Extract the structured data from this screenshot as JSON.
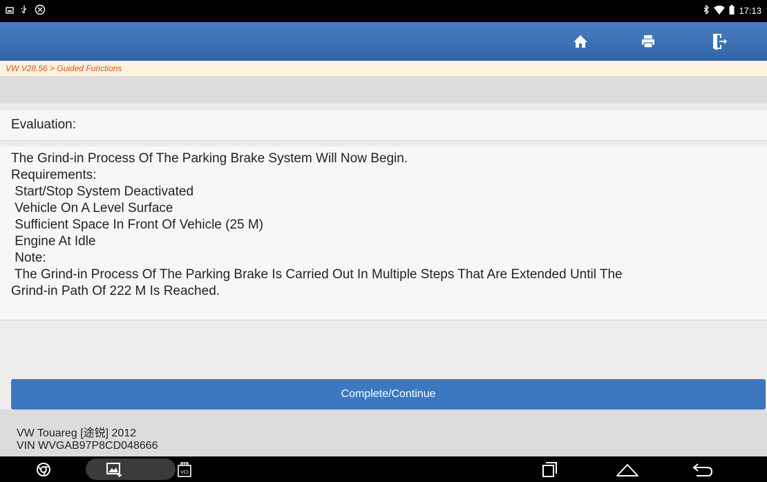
{
  "status_bar": {
    "time": "17:13",
    "left_icons": [
      "image-icon",
      "usb-icon",
      "nfc-icon"
    ],
    "right_icons": [
      "bluetooth-icon",
      "wifi-icon",
      "battery-icon"
    ]
  },
  "toolbar": {
    "buttons": [
      "home-icon",
      "print-icon",
      "exit-icon"
    ]
  },
  "breadcrumb": "VW V28.56 > Guided Functions",
  "evaluation_label": "Evaluation:",
  "content": {
    "lines": [
      "The Grind-in Process Of The Parking Brake System Will Now Begin.",
      "Requirements:",
      " Start/Stop System Deactivated",
      " Vehicle On A Level Surface",
      " Sufficient Space In Front Of Vehicle (25 M)",
      " Engine At Idle",
      " Note:",
      " The Grind-in Process Of The Parking Brake Is Carried Out In Multiple Steps That Are Extended Until The",
      "Grind-in Path Of 222 M Is Reached."
    ]
  },
  "continue_label": "Complete/Continue",
  "vehicle": {
    "model": "VW Touareg [途锐] 2012",
    "vin": "VIN WVGAB97P8CD048666"
  },
  "nav_bar": {
    "items": [
      "chrome-icon",
      "gallery-icon",
      "vci-icon",
      "recents-icon",
      "home-nav-icon",
      "back-icon"
    ],
    "vci_label": "VCI"
  },
  "colors": {
    "app_bar": "#3a71b4",
    "breadcrumb_text": "#d9531e",
    "button": "#3b78bf"
  }
}
